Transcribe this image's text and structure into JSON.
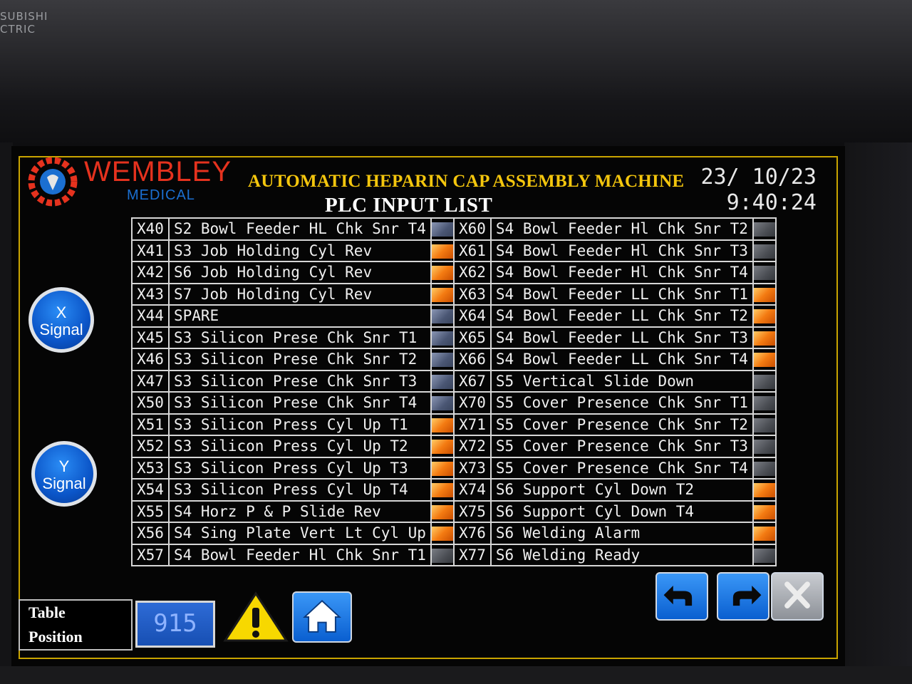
{
  "device": {
    "brand_text": "SUBISHI\nCTRIC"
  },
  "header": {
    "logo_main": "WEMBLEY",
    "logo_sub": "MEDICAL",
    "title": "AUTOMATIC HEPARIN CAP ASSEMBLY MACHINE",
    "subtitle": "PLC INPUT LIST",
    "date": "23/ 10/23",
    "time": "9:40:24"
  },
  "left_buttons": {
    "x_signal": "X Signal",
    "x_line1": "X",
    "x_line2": "Signal",
    "y_line1": "Y",
    "y_line2": "Signal"
  },
  "inputs_left": [
    {
      "addr": "X40",
      "desc": "S2 Bowl Feeder HL Chk Snr T4",
      "state": "off"
    },
    {
      "addr": "X41",
      "desc": "S3 Job Holding Cyl Rev",
      "state": "on"
    },
    {
      "addr": "X42",
      "desc": "S6 Job Holding Cyl Rev",
      "state": "on"
    },
    {
      "addr": "X43",
      "desc": "S7 Job Holding Cyl Rev",
      "state": "on"
    },
    {
      "addr": "X44",
      "desc": "SPARE",
      "state": "off"
    },
    {
      "addr": "X45",
      "desc": "S3 Silicon Prese Chk Snr T1",
      "state": "off"
    },
    {
      "addr": "X46",
      "desc": "S3 Silicon Prese Chk Snr T2",
      "state": "off"
    },
    {
      "addr": "X47",
      "desc": "S3 Silicon Prese Chk Snr T3",
      "state": "off"
    },
    {
      "addr": "X50",
      "desc": "S3 Silicon Prese Chk Snr T4",
      "state": "off"
    },
    {
      "addr": "X51",
      "desc": "S3 Silicon Press Cyl Up T1",
      "state": "on"
    },
    {
      "addr": "X52",
      "desc": "S3 Silicon Press Cyl Up T2",
      "state": "on"
    },
    {
      "addr": "X53",
      "desc": "S3 Silicon Press Cyl Up T3",
      "state": "on"
    },
    {
      "addr": "X54",
      "desc": "S3 Silicon Press Cyl Up T4",
      "state": "on"
    },
    {
      "addr": "X55",
      "desc": "S4 Horz P & P Slide Rev",
      "state": "on"
    },
    {
      "addr": "X56",
      "desc": "S4 Sing Plate Vert Lt Cyl Up",
      "state": "on"
    },
    {
      "addr": "X57",
      "desc": "S4 Bowl Feeder Hl Chk Snr T1",
      "state": "offg"
    }
  ],
  "inputs_right": [
    {
      "addr": "X60",
      "desc": "S4 Bowl Feeder Hl Chk Snr T2",
      "state": "offg"
    },
    {
      "addr": "X61",
      "desc": "S4 Bowl Feeder Hl Chk Snr T3",
      "state": "offg"
    },
    {
      "addr": "X62",
      "desc": "S4 Bowl Feeder Hl Chk Snr T4",
      "state": "offg"
    },
    {
      "addr": "X63",
      "desc": "S4 Bowl Feeder LL Chk Snr T1",
      "state": "on"
    },
    {
      "addr": "X64",
      "desc": "S4 Bowl Feeder LL Chk Snr T2",
      "state": "on"
    },
    {
      "addr": "X65",
      "desc": "S4 Bowl Feeder LL Chk Snr T3",
      "state": "on"
    },
    {
      "addr": "X66",
      "desc": "S4 Bowl Feeder LL Chk Snr T4",
      "state": "on"
    },
    {
      "addr": "X67",
      "desc": "S5 Vertical Slide Down",
      "state": "offg"
    },
    {
      "addr": "X70",
      "desc": "S5 Cover Presence Chk Snr T1",
      "state": "offg"
    },
    {
      "addr": "X71",
      "desc": "S5 Cover Presence Chk Snr T2",
      "state": "offg"
    },
    {
      "addr": "X72",
      "desc": "S5 Cover Presence Chk Snr T3",
      "state": "offg"
    },
    {
      "addr": "X73",
      "desc": "S5 Cover Presence Chk Snr T4",
      "state": "offg"
    },
    {
      "addr": "X74",
      "desc": "S6 Support Cyl Down T2",
      "state": "on"
    },
    {
      "addr": "X75",
      "desc": "S6 Support Cyl Down T4",
      "state": "on"
    },
    {
      "addr": "X76",
      "desc": "S6 Welding Alarm",
      "state": "on"
    },
    {
      "addr": "X77",
      "desc": "S6 Welding Ready",
      "state": "offg"
    }
  ],
  "footer": {
    "table_position_line1": "Table",
    "table_position_line2": "Position",
    "table_position_value": "915"
  },
  "icons": {
    "warning": "warning-icon",
    "home": "home-icon",
    "back": "undo-arrow-icon",
    "forward": "redo-arrow-icon",
    "close": "close-icon"
  },
  "colors": {
    "title": "#f4c60d",
    "frame": "#c9a400",
    "lamp_on": "#f47b12",
    "lamp_off": "#4a5673",
    "button_blue": "#0b55c8"
  }
}
